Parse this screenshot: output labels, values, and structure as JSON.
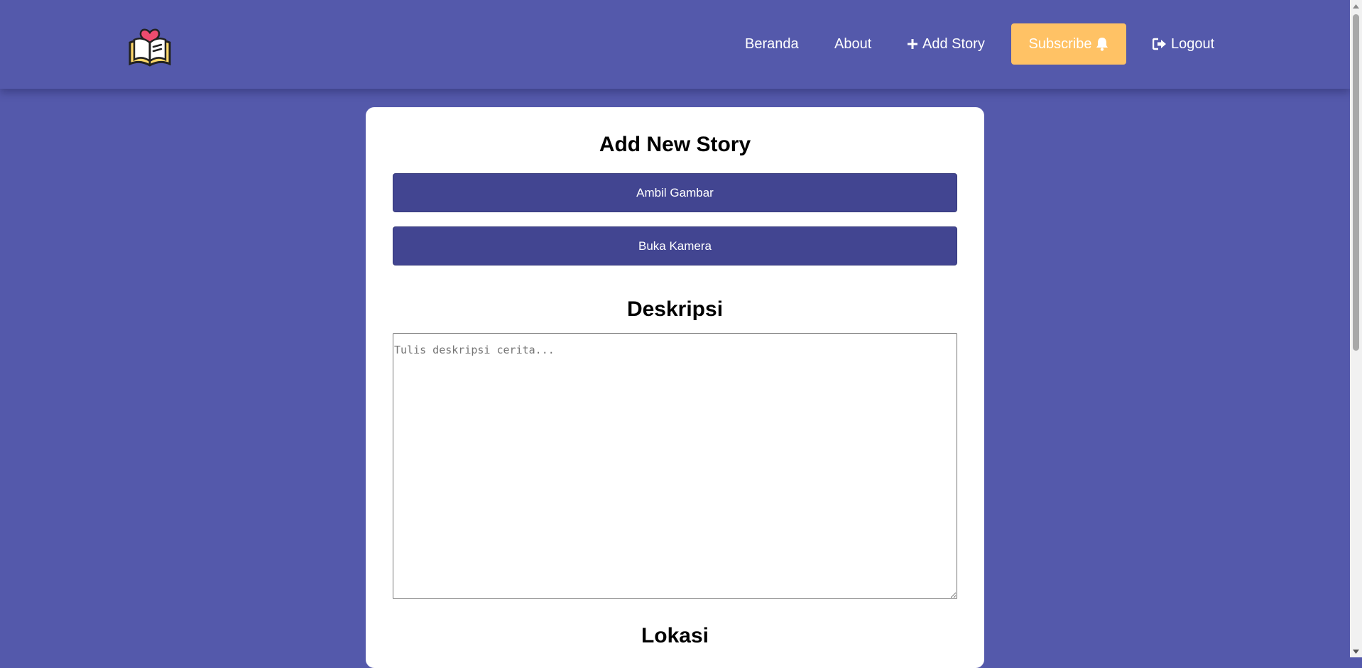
{
  "nav": {
    "logo": "book-heart-logo",
    "links": [
      {
        "label": "Beranda"
      },
      {
        "label": "About"
      },
      {
        "label": "Add Story",
        "icon": "plus-icon"
      },
      {
        "label": "Logout",
        "icon": "logout-icon"
      }
    ],
    "subscribe": {
      "label": "Subscribe",
      "icon": "bell-icon"
    }
  },
  "form": {
    "title": "Add New Story",
    "take_picture_label": "Ambil Gambar",
    "open_camera_label": "Buka Kamera",
    "description_heading": "Deskripsi",
    "description_placeholder": "Tulis deskripsi cerita...",
    "description_value": "",
    "location_heading": "Lokasi"
  },
  "colors": {
    "background": "#5459ab",
    "button": "#424591",
    "subscribe": "#ffc265",
    "card": "#ffffff"
  }
}
